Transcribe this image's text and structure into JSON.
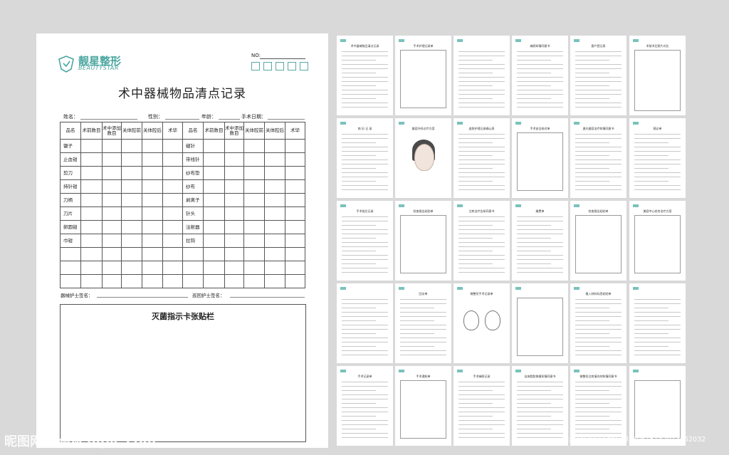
{
  "main_form": {
    "logo_cn": "靓星整形",
    "logo_en": "BEAUTYSTAR",
    "no_label": "NO:",
    "title": "术中器械物品清点记录",
    "fields": {
      "name": "姓名：",
      "gender": "性别：",
      "age": "年龄：",
      "surgery_date": "手术日期："
    },
    "columns": [
      "品名",
      "术前数目",
      "术中添加数目",
      "关体腔前",
      "关体腔后",
      "术毕",
      "品名",
      "术前数目",
      "术中添加数目",
      "关体腔前",
      "关体腔后",
      "术毕"
    ],
    "left_items": [
      "镊子",
      "止血钳",
      "剪刀",
      "持针钳",
      "刀柄",
      "刀片",
      "卵圆钳",
      "巾钳",
      "",
      "",
      ""
    ],
    "right_items": [
      "缝针",
      "带线针",
      "纱布垫",
      "纱布",
      "剥离子",
      "针头",
      "注射器",
      "拉钩",
      "",
      "",
      ""
    ],
    "sig_instrument_nurse": "器械护士签名：",
    "sig_circulating_nurse": "巡回护士签名：",
    "sterilization_title": "灭菌指示卡张贴栏"
  },
  "thumbnails": [
    "术中器械物品清点记录",
    "手术护理记录单",
    "",
    "麻醉知情同意书",
    "客户登记表",
    "术前术后照片对比",
    "病 历 记 录",
    "美容外科诊疗方案",
    "皮肤护理记录确认表",
    "手术安全核对单",
    "激光美容治疗知情同意书",
    "随诊单",
    "手术前后记录",
    "检查报告粘贴单",
    "注射治疗告知同意书",
    "缴费单",
    "检查报告粘贴单",
    "美容中心综合治疗方案",
    "",
    "回访单",
    "微整形手术记录单",
    "",
    "植入材料标签粘贴单",
    "",
    "手术记录单",
    "手术通知单",
    "手术麻醉记录",
    "自体脂肪移植知情同意书",
    "微整形注射填充剂知情同意书",
    ""
  ],
  "watermark_left": "昵图网 www.nipic.com",
  "watermark_right": "ID:23450273 NO:20180615142913252032"
}
